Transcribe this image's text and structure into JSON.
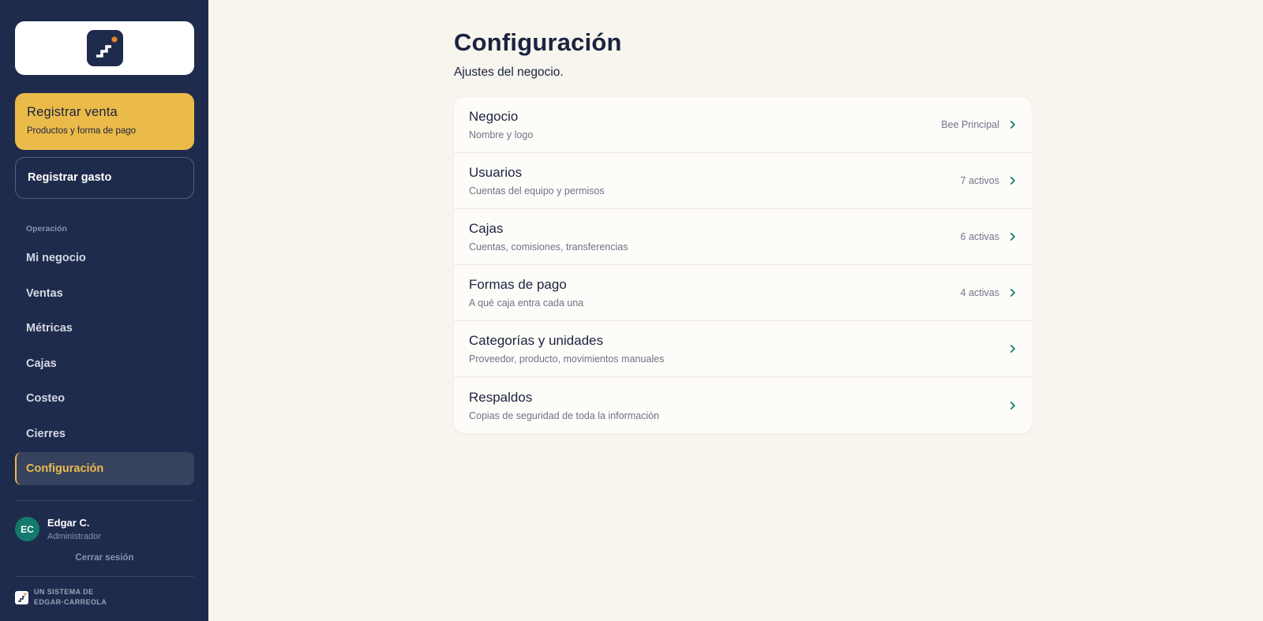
{
  "sidebar": {
    "cta_primary": {
      "title": "Registrar venta",
      "subtitle": "Productos y forma de pago"
    },
    "cta_secondary": {
      "label": "Registrar gasto"
    },
    "section_label": "Operación",
    "nav": [
      {
        "label": "Mi negocio"
      },
      {
        "label": "Ventas"
      },
      {
        "label": "Métricas"
      },
      {
        "label": "Cajas"
      },
      {
        "label": "Costeo"
      },
      {
        "label": "Cierres"
      },
      {
        "label": "Configuración",
        "active": true
      }
    ],
    "user": {
      "initials": "EC",
      "name": "Edgar C.",
      "role": "Administrador"
    },
    "logout_label": "Cerrar sesión",
    "footer": {
      "line1": "UN SISTEMA DE",
      "line2": "EDGAR·CARREOLA"
    }
  },
  "main": {
    "title": "Configuración",
    "subtitle": "Ajustes del negocio.",
    "settings": [
      {
        "title": "Negocio",
        "description": "Nombre y logo",
        "value": "Bee Principal"
      },
      {
        "title": "Usuarios",
        "description": "Cuentas del equipo y permisos",
        "value": "7 activos"
      },
      {
        "title": "Cajas",
        "description": "Cuentas, comisiones, transferencias",
        "value": "6 activas"
      },
      {
        "title": "Formas de pago",
        "description": "A qué caja entra cada una",
        "value": "4 activas"
      },
      {
        "title": "Categorías y unidades",
        "description": "Proveedor, producto, movimientos manuales",
        "value": ""
      },
      {
        "title": "Respaldos",
        "description": "Copias de seguridad de toda la información",
        "value": ""
      }
    ]
  },
  "colors": {
    "sidebar_bg": "#1f2b4c",
    "accent": "#ebbb4a",
    "page_bg": "#f8f4ee",
    "card_bg": "#fefcf8",
    "avatar_bg": "#137a6c",
    "chevron": "#137a6c",
    "logo_dot": "#e8852a"
  }
}
